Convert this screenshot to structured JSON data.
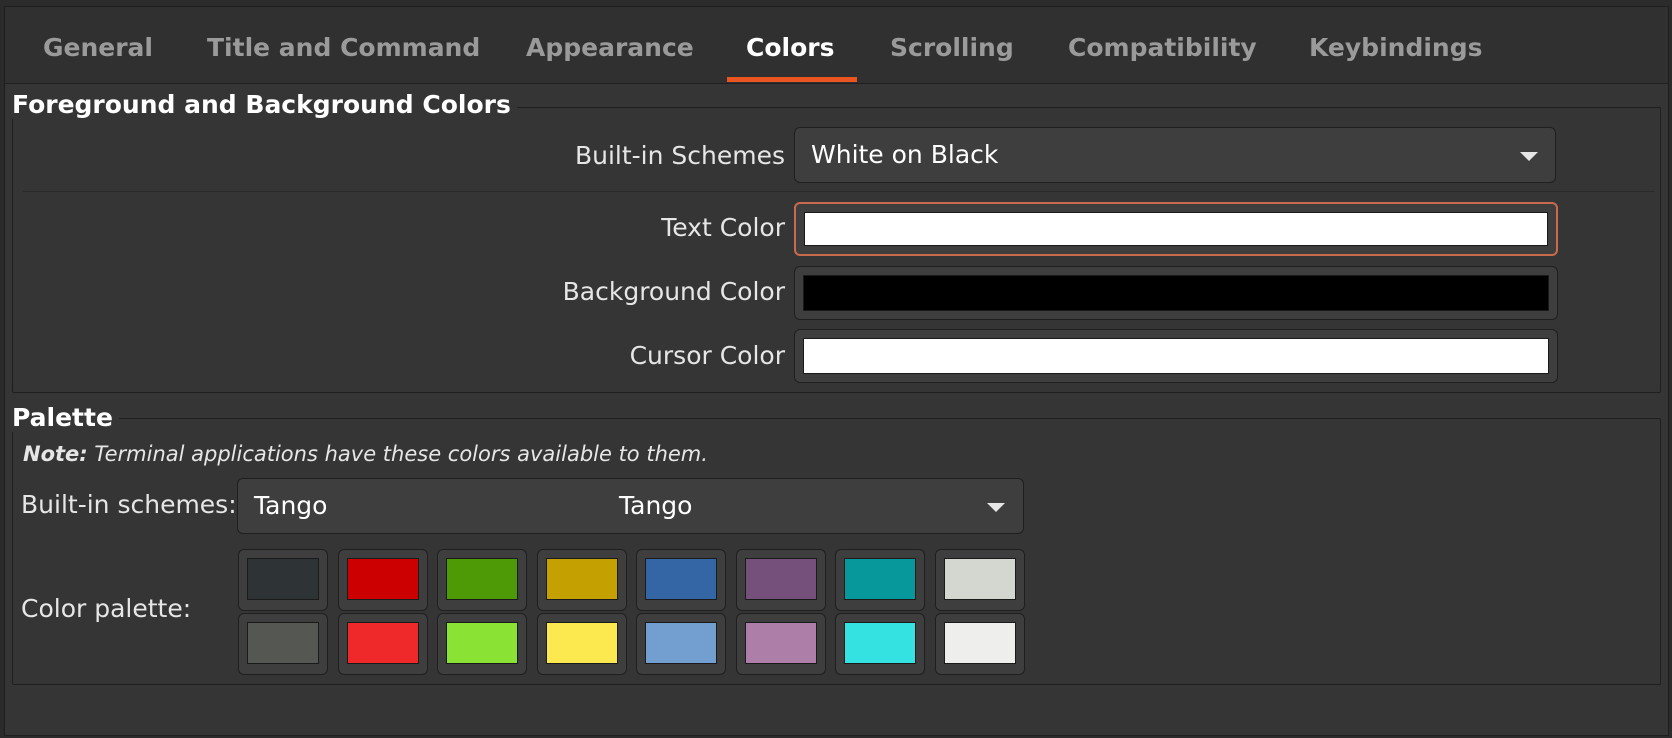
{
  "tabs": [
    {
      "label": "General",
      "active": false
    },
    {
      "label": "Title and Command",
      "active": false
    },
    {
      "label": "Appearance",
      "active": false
    },
    {
      "label": "Colors",
      "active": true
    },
    {
      "label": "Scrolling",
      "active": false
    },
    {
      "label": "Compatibility",
      "active": false
    },
    {
      "label": "Keybindings",
      "active": false
    }
  ],
  "fg_bg": {
    "title": "Foreground and Background Colors",
    "builtin_label": "Built-in Schemes",
    "builtin_value": "White on Black",
    "text_color_label": "Text Color",
    "text_color": "#ffffff",
    "background_color_label": "Background Color",
    "background_color": "#000000",
    "cursor_color_label": "Cursor Color",
    "cursor_color": "#ffffff"
  },
  "palette": {
    "title": "Palette",
    "note_bold": "Note:",
    "note_text": " Terminal applications have these colors available to them.",
    "builtin_label": "Built-in schemes:",
    "builtin_value_left": "Tango",
    "builtin_value_center": "Tango",
    "color_palette_label": "Color palette:",
    "row1": [
      "#2e3436",
      "#cc0000",
      "#4e9a06",
      "#c4a000",
      "#3465a4",
      "#75507b",
      "#06989a",
      "#d3d7cf"
    ],
    "row2": [
      "#555753",
      "#ef2929",
      "#8ae234",
      "#fce94f",
      "#729fcf",
      "#ad7fa8",
      "#34e2e2",
      "#eeeeec"
    ]
  },
  "accent": "#e95420"
}
